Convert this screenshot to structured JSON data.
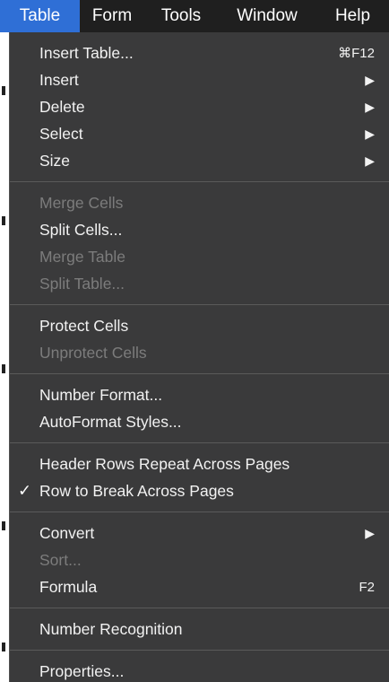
{
  "menubar": {
    "items": [
      {
        "label": "Table",
        "active": true
      },
      {
        "label": "Form",
        "active": false
      },
      {
        "label": "Tools",
        "active": false
      },
      {
        "label": "Window",
        "active": false
      },
      {
        "label": "Help",
        "active": false
      }
    ]
  },
  "menu": {
    "insert_table": {
      "label": "Insert Table...",
      "shortcut": "⌘F12"
    },
    "insert": {
      "label": "Insert",
      "submenu": "▶"
    },
    "delete": {
      "label": "Delete",
      "submenu": "▶"
    },
    "select": {
      "label": "Select",
      "submenu": "▶"
    },
    "size": {
      "label": "Size",
      "submenu": "▶"
    },
    "merge_cells": {
      "label": "Merge Cells",
      "enabled": false
    },
    "split_cells": {
      "label": "Split Cells...",
      "enabled": true
    },
    "merge_table": {
      "label": "Merge Table",
      "enabled": false
    },
    "split_table": {
      "label": "Split Table...",
      "enabled": false
    },
    "protect_cells": {
      "label": "Protect Cells",
      "enabled": true
    },
    "unprotect_cells": {
      "label": "Unprotect Cells",
      "enabled": false
    },
    "number_format": {
      "label": "Number Format..."
    },
    "autoformat_styles": {
      "label": "AutoFormat Styles..."
    },
    "header_rows_repeat": {
      "label": "Header Rows Repeat Across Pages"
    },
    "row_to_break": {
      "label": "Row to Break Across Pages",
      "checked": true,
      "check": "✓"
    },
    "convert": {
      "label": "Convert",
      "submenu": "▶"
    },
    "sort": {
      "label": "Sort...",
      "enabled": false
    },
    "formula": {
      "label": "Formula",
      "shortcut": "F2"
    },
    "number_recognition": {
      "label": "Number Recognition"
    },
    "properties": {
      "label": "Properties..."
    }
  },
  "colors": {
    "accent": "#2f6fd6",
    "menu_bg": "#3a3a3b",
    "disabled_text": "#7c7c7c"
  }
}
